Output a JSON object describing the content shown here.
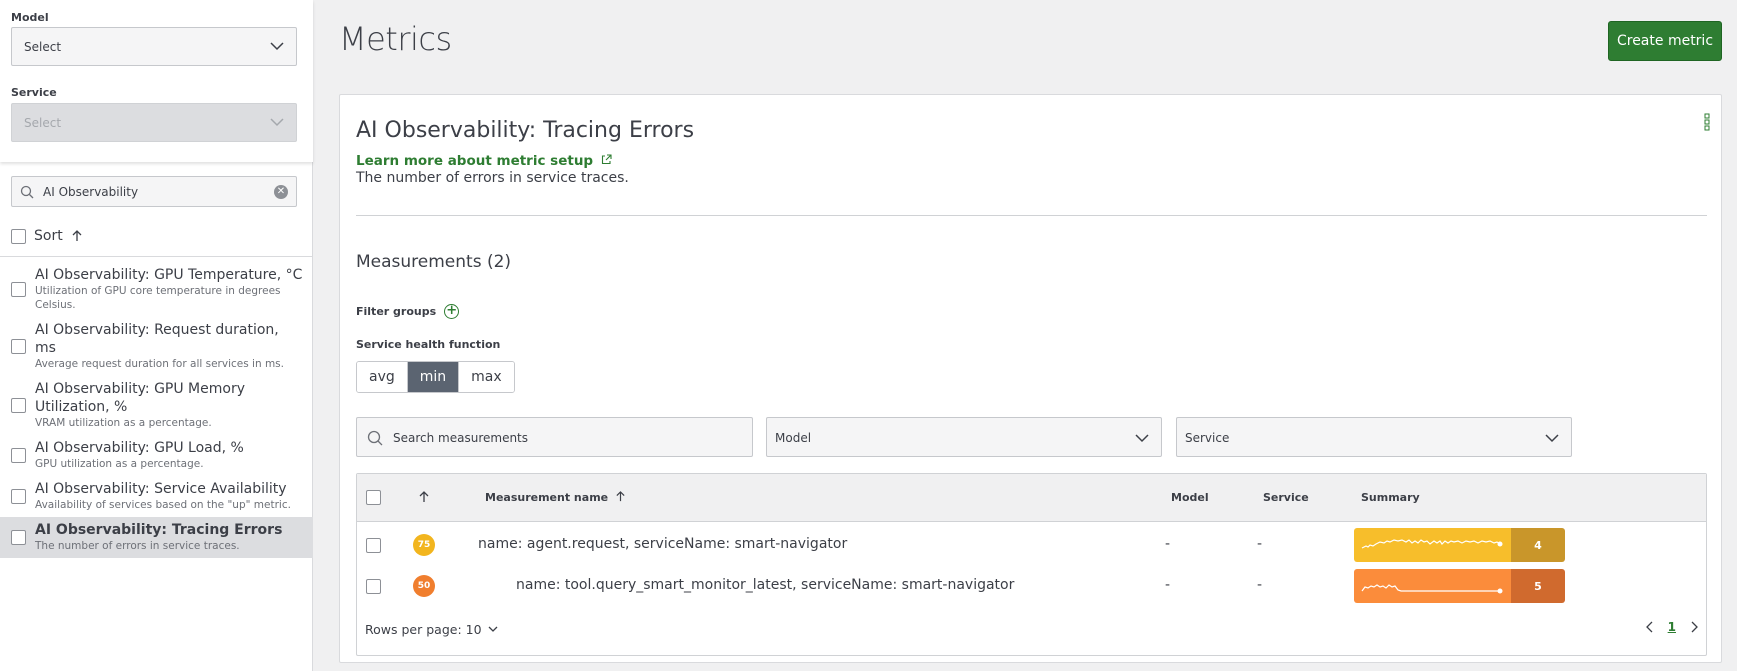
{
  "sidebar": {
    "model_label": "Model",
    "model_select": "Select",
    "service_label": "Service",
    "service_select": "Select",
    "search_value": "AI Observability",
    "sort_label": "Sort",
    "items": [
      {
        "title": "AI Observability: GPU Temperature, °C",
        "desc": "Utilization of GPU core temperature in degrees Celsius."
      },
      {
        "title": "AI Observability: Request duration, ms",
        "desc": "Average request duration for all services in ms."
      },
      {
        "title": "AI Observability: GPU Memory Utilization, %",
        "desc": "VRAM utilization as a percentage."
      },
      {
        "title": "AI Observability: GPU Load, %",
        "desc": "GPU utilization as a percentage."
      },
      {
        "title": "AI Observability: Service Availability",
        "desc": "Availability of services based on the \"up\" metric."
      },
      {
        "title": "AI Observability: Tracing Errors",
        "desc": "The number of errors in service traces."
      }
    ]
  },
  "header": {
    "title": "Metrics",
    "create_button": "Create metric"
  },
  "card": {
    "title": "AI Observability: Tracing Errors",
    "learn_more": "Learn more about metric setup",
    "description": "The number of errors in service traces.",
    "measurements_heading": "Measurements (2)",
    "filter_groups": "Filter groups",
    "health_function_label": "Service health function",
    "health_options": [
      "avg",
      "min",
      "max"
    ],
    "health_selected": "min",
    "search_placeholder": "Search measurements",
    "model_dropdown": "Model",
    "service_dropdown": "Service"
  },
  "table": {
    "headers": {
      "name": "Measurement name",
      "model": "Model",
      "service": "Service",
      "summary": "Summary"
    },
    "rows": [
      {
        "score": "75",
        "score_color": "#f2b51e",
        "name": "name: agent.request, serviceName: smart-navigator",
        "model": "-",
        "service": "-",
        "summary_value": "4",
        "bar_color": "#f7be2b",
        "num_color": "#c9962a"
      },
      {
        "score": "50",
        "score_color": "#f07e2e",
        "name": "name: tool.query_smart_monitor_latest, serviceName: smart-navigator",
        "model": "-",
        "service": "-",
        "summary_value": "5",
        "bar_color": "#fb8c3b",
        "num_color": "#d06a2e"
      }
    ],
    "rows_per_page": "Rows per page: 10",
    "current_page": "1"
  },
  "colors": {
    "accent": "#2e7d32",
    "segment_active": "#5b6471"
  }
}
